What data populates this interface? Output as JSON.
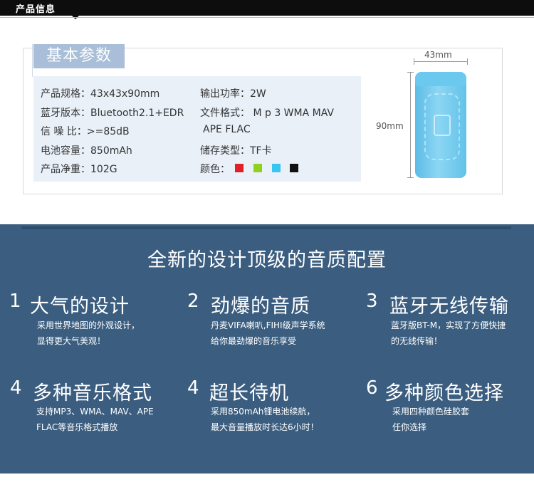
{
  "header": {
    "title": "产品信息"
  },
  "card": {
    "tab": "基本参数",
    "specs": {
      "size": "产品规格：43x43x90mm",
      "power": "输出功率：2W",
      "bluetooth": "蓝牙版本：Bluetooth2.1+EDR",
      "format": "文件格式：  M p 3  WMA MAV",
      "format_cont": "APE FLAC",
      "snr": "信 噪  比：>=85dB",
      "battery": "电池容量：850mAh",
      "storage": "储存类型：TF卡",
      "weight": "产品净重：102G",
      "color_label": "颜色："
    },
    "colors": [
      "#e11f26",
      "#8ed21e",
      "#39c5f1",
      "#111111"
    ]
  },
  "product": {
    "width_label": "43mm",
    "height_label": "90mm"
  },
  "features": {
    "headline": "全新的设计顶级的音质配置",
    "items": [
      {
        "num": "1",
        "title": "大气的设计",
        "desc1": "采用世界地图的外观设计，",
        "desc2": "显得更大气美观！"
      },
      {
        "num": "2",
        "title": "劲爆的音质",
        "desc1": "丹麦VIFA喇叭,FIHI级声学系统",
        "desc2": "给你最劲爆的音乐享受"
      },
      {
        "num": "3",
        "title": "蓝牙无线传输",
        "desc1": "蓝牙版BT-M，实现了方便快捷",
        "desc2": "的无线传输！"
      },
      {
        "num": "4",
        "title": "多种音乐格式",
        "desc1": "支持MP3、WMA、MAV、APE",
        "desc2": "FLAC等音乐格式播放"
      },
      {
        "num": "4",
        "title": "超长待机",
        "desc1": "采用850mAh锂电池续航，",
        "desc2": "最大音量播放时长达6小时！"
      },
      {
        "num": "6",
        "title": "多种颜色选择",
        "desc1": "采用四种颜色硅胶套",
        "desc2": "任你选择"
      }
    ]
  }
}
